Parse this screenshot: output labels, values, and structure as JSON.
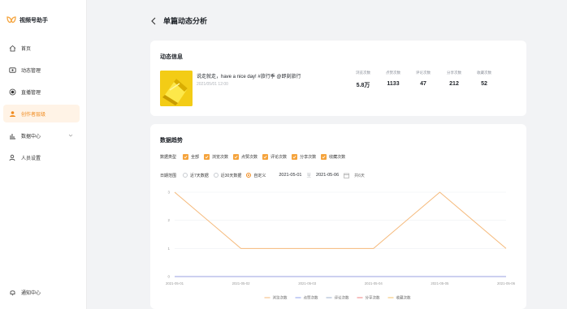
{
  "app": {
    "name": "视频号助手",
    "accent": "#f08a1c"
  },
  "sidebar": {
    "items": [
      {
        "label": "首页",
        "icon": "home-icon"
      },
      {
        "label": "动态管理",
        "icon": "video-icon"
      },
      {
        "label": "直播管理",
        "icon": "live-icon"
      },
      {
        "label": "创作者层级",
        "icon": "creator-icon",
        "active": true
      },
      {
        "label": "数据中心",
        "icon": "chart-icon",
        "has_children": true
      },
      {
        "label": "人员设置",
        "icon": "user-icon"
      }
    ],
    "notification": "通知中心"
  },
  "header": {
    "title": "单篇动态分析"
  },
  "info_card": {
    "title": "动态信息",
    "post": {
      "title": "说走就走，have a nice day! #旅行季 @即刻旅行",
      "date": "2021/05/01 12:00"
    },
    "stats": [
      {
        "label": "浏览次数",
        "value": "5.8万"
      },
      {
        "label": "点赞次数",
        "value": "1133"
      },
      {
        "label": "评论次数",
        "value": "47"
      },
      {
        "label": "分享次数",
        "value": "212"
      },
      {
        "label": "收藏次数",
        "value": "52"
      }
    ]
  },
  "trend_card": {
    "title": "数据趋势",
    "type_label": "数据类型",
    "types": [
      "全部",
      "浏览次数",
      "点赞次数",
      "评论次数",
      "分享次数",
      "收藏次数"
    ],
    "range_label": "日期范围",
    "range_options": [
      "近7天数据",
      "近30天数据",
      "自定义"
    ],
    "selected_range": "自定义",
    "start_date": "2021-05-01",
    "date_sep": "至",
    "end_date": "2021-05-06",
    "range_info": "共6天"
  },
  "chart_data": {
    "type": "line",
    "x": [
      "2021-05-01",
      "2021-05-02",
      "2021-05-03",
      "2021-05-04",
      "2021-05-05",
      "2021-05-06"
    ],
    "ylim": [
      0,
      3
    ],
    "yticks": [
      "0",
      "1",
      "2",
      "3"
    ],
    "grid": true,
    "legend_position": "bottom",
    "series": [
      {
        "name": "浏览次数",
        "color": "#f5b97a",
        "values": [
          3,
          1,
          1,
          1,
          3,
          1
        ]
      },
      {
        "name": "点赞次数",
        "color": "#8fa0ee",
        "values": [
          0,
          0,
          0,
          0,
          0,
          0
        ]
      },
      {
        "name": "评论次数",
        "color": "#9fb0cc",
        "values": [
          0,
          0,
          0,
          0,
          0,
          0
        ]
      },
      {
        "name": "分享次数",
        "color": "#f08080",
        "values": [
          0,
          0,
          0,
          0,
          0,
          0
        ]
      },
      {
        "name": "收藏次数",
        "color": "#f5c36a",
        "values": [
          0,
          0,
          0,
          0,
          0,
          0
        ]
      }
    ]
  }
}
